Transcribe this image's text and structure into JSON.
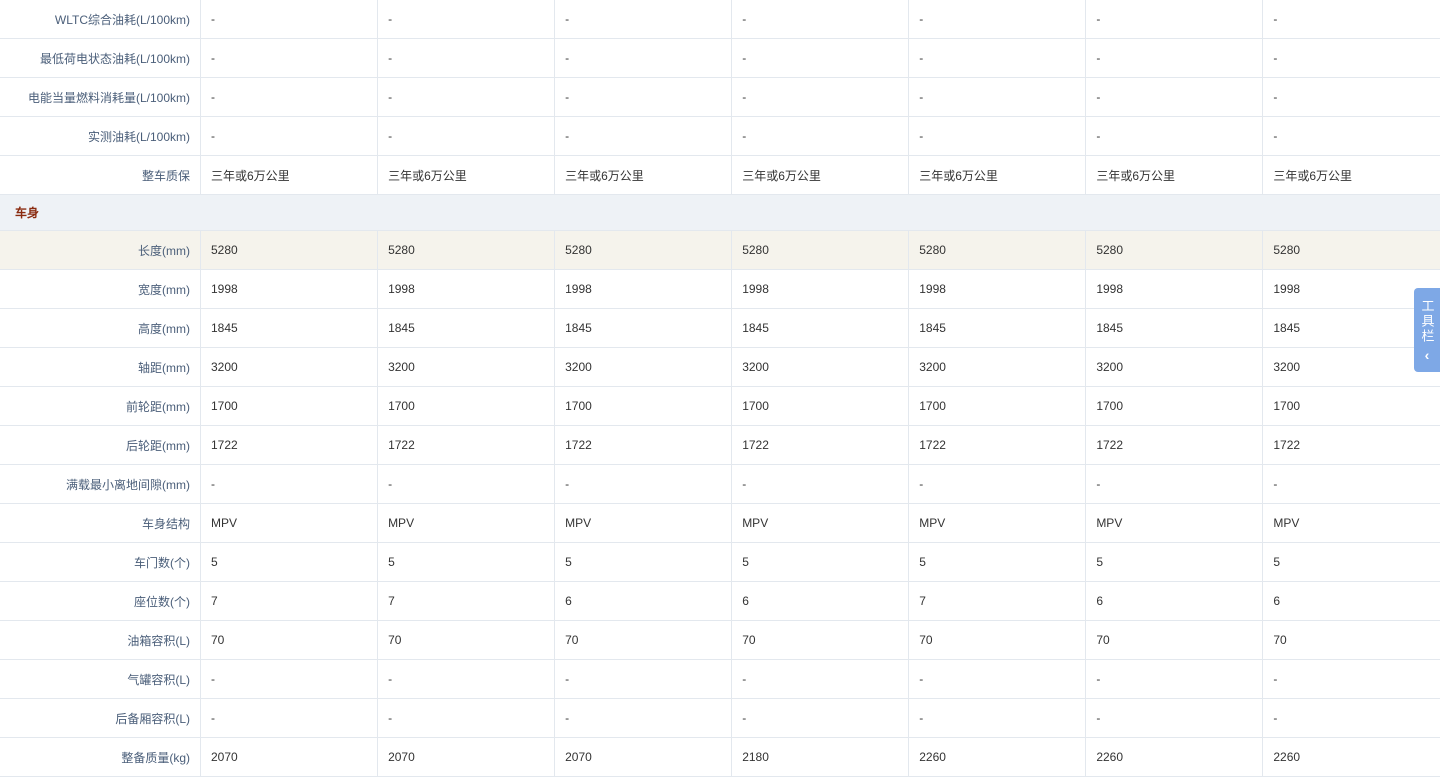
{
  "rows": [
    {
      "label": "WLTC综合油耗(L/100km)",
      "values": [
        "-",
        "-",
        "-",
        "-",
        "-",
        "-",
        "-"
      ]
    },
    {
      "label": "最低荷电状态油耗(L/100km)",
      "values": [
        "-",
        "-",
        "-",
        "-",
        "-",
        "-",
        "-"
      ]
    },
    {
      "label": "电能当量燃料消耗量(L/100km)",
      "values": [
        "-",
        "-",
        "-",
        "-",
        "-",
        "-",
        "-"
      ]
    },
    {
      "label": "实测油耗(L/100km)",
      "values": [
        "-",
        "-",
        "-",
        "-",
        "-",
        "-",
        "-"
      ]
    },
    {
      "label": "整车质保",
      "values": [
        "三年或6万公里",
        "三年或6万公里",
        "三年或6万公里",
        "三年或6万公里",
        "三年或6万公里",
        "三年或6万公里",
        "三年或6万公里"
      ]
    },
    {
      "section": "车身"
    },
    {
      "label": "长度(mm)",
      "values": [
        "5280",
        "5280",
        "5280",
        "5280",
        "5280",
        "5280",
        "5280"
      ],
      "highlight": true
    },
    {
      "label": "宽度(mm)",
      "values": [
        "1998",
        "1998",
        "1998",
        "1998",
        "1998",
        "1998",
        "1998"
      ]
    },
    {
      "label": "高度(mm)",
      "values": [
        "1845",
        "1845",
        "1845",
        "1845",
        "1845",
        "1845",
        "1845"
      ]
    },
    {
      "label": "轴距(mm)",
      "values": [
        "3200",
        "3200",
        "3200",
        "3200",
        "3200",
        "3200",
        "3200"
      ]
    },
    {
      "label": "前轮距(mm)",
      "values": [
        "1700",
        "1700",
        "1700",
        "1700",
        "1700",
        "1700",
        "1700"
      ]
    },
    {
      "label": "后轮距(mm)",
      "values": [
        "1722",
        "1722",
        "1722",
        "1722",
        "1722",
        "1722",
        "1722"
      ]
    },
    {
      "label": "满载最小离地间隙(mm)",
      "values": [
        "-",
        "-",
        "-",
        "-",
        "-",
        "-",
        "-"
      ]
    },
    {
      "label": "车身结构",
      "values": [
        "MPV",
        "MPV",
        "MPV",
        "MPV",
        "MPV",
        "MPV",
        "MPV"
      ]
    },
    {
      "label": "车门数(个)",
      "values": [
        "5",
        "5",
        "5",
        "5",
        "5",
        "5",
        "5"
      ]
    },
    {
      "label": "座位数(个)",
      "values": [
        "7",
        "7",
        "6",
        "6",
        "7",
        "6",
        "6"
      ]
    },
    {
      "label": "油箱容积(L)",
      "values": [
        "70",
        "70",
        "70",
        "70",
        "70",
        "70",
        "70"
      ]
    },
    {
      "label": "气罐容积(L)",
      "values": [
        "-",
        "-",
        "-",
        "-",
        "-",
        "-",
        "-"
      ]
    },
    {
      "label": "后备厢容积(L)",
      "values": [
        "-",
        "-",
        "-",
        "-",
        "-",
        "-",
        "-"
      ]
    },
    {
      "label": "整备质量(kg)",
      "values": [
        "2070",
        "2070",
        "2070",
        "2180",
        "2260",
        "2260",
        "2260"
      ]
    }
  ],
  "toolbar": {
    "label": "工具栏",
    "icon": "chevron-left-icon"
  },
  "colors": {
    "label_text": "#4a5e79",
    "section_text": "#8a2b10",
    "section_bg": "#eef2f6",
    "highlight_bg": "#f5f3ec",
    "toolbar_bg": "#7ea8e6"
  }
}
